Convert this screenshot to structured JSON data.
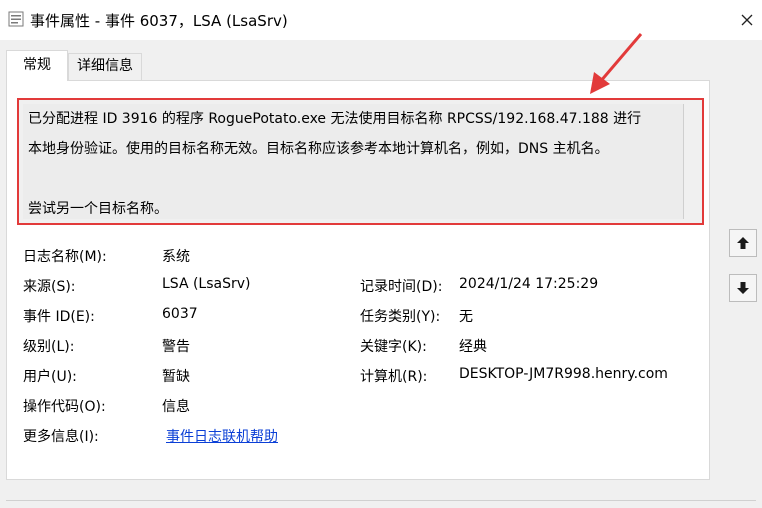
{
  "window": {
    "title": "事件属性 - 事件 6037，LSA (LsaSrv)"
  },
  "tabs": [
    {
      "label": "常规",
      "active": true
    },
    {
      "label": "详细信息",
      "active": false
    }
  ],
  "description": {
    "lines": [
      "已分配进程 ID 3916 的程序 RoguePotato.exe 无法使用目标名称 RPCSS/192.168.47.188 进行",
      "本地身份验证。使用的目标名称无效。目标名称应该参考本地计算机名，例如，DNS 主机名。",
      "",
      "尝试另一个目标名称。"
    ]
  },
  "fields": {
    "log_name": {
      "label": "日志名称(M):",
      "value": "系统"
    },
    "source": {
      "label": "来源(S):",
      "value": "LSA (LsaSrv)"
    },
    "logged": {
      "label": "记录时间(D):",
      "value": "2024/1/24 17:25:29"
    },
    "event_id": {
      "label": "事件 ID(E):",
      "value": "6037"
    },
    "task_category": {
      "label": "任务类别(Y):",
      "value": "无"
    },
    "level": {
      "label": "级别(L):",
      "value": "警告"
    },
    "keywords": {
      "label": "关键字(K):",
      "value": "经典"
    },
    "user": {
      "label": "用户(U):",
      "value": "暂缺"
    },
    "computer": {
      "label": "计算机(R):",
      "value": "DESKTOP-JM7R998.henry.com"
    },
    "opcode": {
      "label": "操作代码(O):",
      "value": "信息"
    },
    "more_info": {
      "label": "更多信息(I):",
      "value": "事件日志联机帮助"
    }
  },
  "colors": {
    "highlight_border": "#e23a3a",
    "link": "#0b3fd6"
  },
  "icons": [
    "event-icon",
    "close-icon",
    "arrow-up-icon",
    "arrow-down-icon"
  ]
}
